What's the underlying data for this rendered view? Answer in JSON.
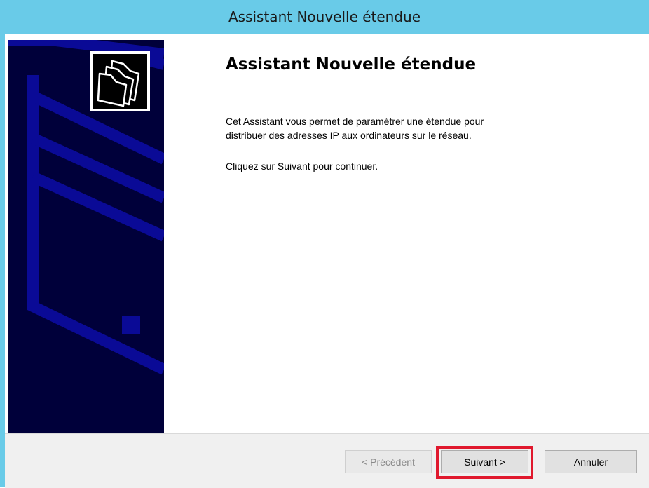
{
  "window": {
    "title": "Assistant Nouvelle étendue"
  },
  "icons": {
    "banner_icon": "folders-icon"
  },
  "content": {
    "heading": "Assistant Nouvelle étendue",
    "paragraph1_line1": "Cet Assistant vous permet de paramétrer une étendue pour",
    "paragraph1_line2": "distribuer des adresses IP aux ordinateurs sur le réseau.",
    "paragraph2": "Cliquez sur Suivant pour continuer."
  },
  "buttons": {
    "previous": "< Précédent",
    "next": "Suivant >",
    "cancel": "Annuler"
  },
  "colors": {
    "titlebar": "#69cbe8",
    "banner": "#00003a",
    "highlight": "#e0182d"
  }
}
